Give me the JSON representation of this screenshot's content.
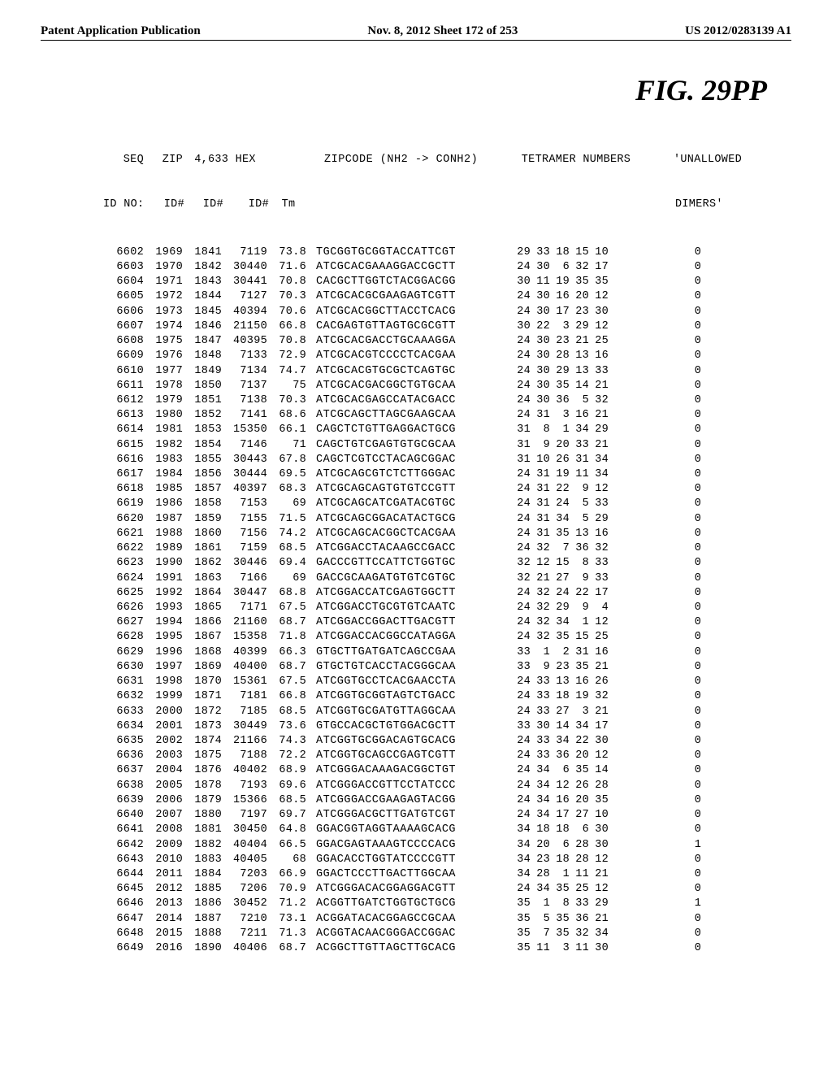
{
  "header": {
    "left": "Patent Application Publication",
    "mid": "Nov. 8, 2012  Sheet 172 of 253",
    "right": "US 2012/0283139 A1"
  },
  "figure_label": "FIG.  29PP",
  "columns": {
    "top": [
      "SEQ",
      "ZIP",
      "4,633 HEX",
      "",
      "ZIPCODE (NH2 -> CONH2)",
      "TETRAMER NUMBERS",
      "'UNALLOWED"
    ],
    "sub": [
      "ID NO:",
      "ID#",
      "ID#",
      "ID#",
      "Tm",
      "",
      "",
      "DIMERS'"
    ]
  },
  "rows": [
    {
      "seq": "6602",
      "zip": "1969",
      "h1": "1841",
      "h2": "7119",
      "tm": "73.8",
      "zc": "TGCGGTGCGGTACCATTCGT",
      "tet": [
        "29",
        "33",
        "18",
        "15",
        "10"
      ],
      "un": "0"
    },
    {
      "seq": "6603",
      "zip": "1970",
      "h1": "1842",
      "h2": "30440",
      "tm": "71.6",
      "zc": "ATCGCACGAAAGGACCGCTT",
      "tet": [
        "24",
        "30",
        "6",
        "32",
        "17"
      ],
      "un": "0"
    },
    {
      "seq": "6604",
      "zip": "1971",
      "h1": "1843",
      "h2": "30441",
      "tm": "70.8",
      "zc": "CACGCTTGGTCTACGGACGG",
      "tet": [
        "30",
        "11",
        "19",
        "35",
        "35"
      ],
      "un": "0"
    },
    {
      "seq": "6605",
      "zip": "1972",
      "h1": "1844",
      "h2": "7127",
      "tm": "70.3",
      "zc": "ATCGCACGCGAAGAGTCGTT",
      "tet": [
        "24",
        "30",
        "16",
        "20",
        "12"
      ],
      "un": "0"
    },
    {
      "seq": "6606",
      "zip": "1973",
      "h1": "1845",
      "h2": "40394",
      "tm": "70.6",
      "zc": "ATCGCACGGCTTACCTCACG",
      "tet": [
        "24",
        "30",
        "17",
        "23",
        "30"
      ],
      "un": "0"
    },
    {
      "seq": "6607",
      "zip": "1974",
      "h1": "1846",
      "h2": "21150",
      "tm": "66.8",
      "zc": "CACGAGTGTTAGTGCGCGTT",
      "tet": [
        "30",
        "22",
        "3",
        "29",
        "12"
      ],
      "un": "0"
    },
    {
      "seq": "6608",
      "zip": "1975",
      "h1": "1847",
      "h2": "40395",
      "tm": "70.8",
      "zc": "ATCGCACGACCTGCAAAGGA",
      "tet": [
        "24",
        "30",
        "23",
        "21",
        "25"
      ],
      "un": "0"
    },
    {
      "seq": "6609",
      "zip": "1976",
      "h1": "1848",
      "h2": "7133",
      "tm": "72.9",
      "zc": "ATCGCACGTCCCCTCACGAA",
      "tet": [
        "24",
        "30",
        "28",
        "13",
        "16"
      ],
      "un": "0"
    },
    {
      "seq": "6610",
      "zip": "1977",
      "h1": "1849",
      "h2": "7134",
      "tm": "74.7",
      "zc": "ATCGCACGTGCGCTCAGTGC",
      "tet": [
        "24",
        "30",
        "29",
        "13",
        "33"
      ],
      "un": "0"
    },
    {
      "seq": "6611",
      "zip": "1978",
      "h1": "1850",
      "h2": "7137",
      "tm": "75",
      "zc": "ATCGCACGACGGCTGTGCAA",
      "tet": [
        "24",
        "30",
        "35",
        "14",
        "21"
      ],
      "un": "0"
    },
    {
      "seq": "6612",
      "zip": "1979",
      "h1": "1851",
      "h2": "7138",
      "tm": "70.3",
      "zc": "ATCGCACGAGCCATACGACC",
      "tet": [
        "24",
        "30",
        "36",
        "5",
        "32"
      ],
      "un": "0"
    },
    {
      "seq": "6613",
      "zip": "1980",
      "h1": "1852",
      "h2": "7141",
      "tm": "68.6",
      "zc": "ATCGCAGCTTAGCGAAGCAA",
      "tet": [
        "24",
        "31",
        "3",
        "16",
        "21"
      ],
      "un": "0"
    },
    {
      "seq": "6614",
      "zip": "1981",
      "h1": "1853",
      "h2": "15350",
      "tm": "66.1",
      "zc": "CAGCTCTGTTGAGGACTGCG",
      "tet": [
        "31",
        "8",
        "1",
        "34",
        "29"
      ],
      "un": "0"
    },
    {
      "seq": "6615",
      "zip": "1982",
      "h1": "1854",
      "h2": "7146",
      "tm": "71",
      "zc": "CAGCTGTCGAGTGTGCGCAA",
      "tet": [
        "31",
        "9",
        "20",
        "33",
        "21"
      ],
      "un": "0"
    },
    {
      "seq": "6616",
      "zip": "1983",
      "h1": "1855",
      "h2": "30443",
      "tm": "67.8",
      "zc": "CAGCTCGTCCTACAGCGGAC",
      "tet": [
        "31",
        "10",
        "26",
        "31",
        "34"
      ],
      "un": "0"
    },
    {
      "seq": "6617",
      "zip": "1984",
      "h1": "1856",
      "h2": "30444",
      "tm": "69.5",
      "zc": "ATCGCAGCGTCTCTTGGGAC",
      "tet": [
        "24",
        "31",
        "19",
        "11",
        "34"
      ],
      "un": "0"
    },
    {
      "seq": "6618",
      "zip": "1985",
      "h1": "1857",
      "h2": "40397",
      "tm": "68.3",
      "zc": "ATCGCAGCAGTGTGTCCGTT",
      "tet": [
        "24",
        "31",
        "22",
        "9",
        "12"
      ],
      "un": "0"
    },
    {
      "seq": "6619",
      "zip": "1986",
      "h1": "1858",
      "h2": "7153",
      "tm": "69",
      "zc": "ATCGCAGCATCGATACGTGC",
      "tet": [
        "24",
        "31",
        "24",
        "5",
        "33"
      ],
      "un": "0"
    },
    {
      "seq": "6620",
      "zip": "1987",
      "h1": "1859",
      "h2": "7155",
      "tm": "71.5",
      "zc": "ATCGCAGCGGACATACTGCG",
      "tet": [
        "24",
        "31",
        "34",
        "5",
        "29"
      ],
      "un": "0"
    },
    {
      "seq": "6621",
      "zip": "1988",
      "h1": "1860",
      "h2": "7156",
      "tm": "74.2",
      "zc": "ATCGCAGCACGGCTCACGAA",
      "tet": [
        "24",
        "31",
        "35",
        "13",
        "16"
      ],
      "un": "0"
    },
    {
      "seq": "6622",
      "zip": "1989",
      "h1": "1861",
      "h2": "7159",
      "tm": "68.5",
      "zc": "ATCGGACCTACAAGCCGACC",
      "tet": [
        "24",
        "32",
        "7",
        "36",
        "32"
      ],
      "un": "0"
    },
    {
      "seq": "6623",
      "zip": "1990",
      "h1": "1862",
      "h2": "30446",
      "tm": "69.4",
      "zc": "GACCCGTTCCATTCTGGTGC",
      "tet": [
        "32",
        "12",
        "15",
        "8",
        "33"
      ],
      "un": "0"
    },
    {
      "seq": "6624",
      "zip": "1991",
      "h1": "1863",
      "h2": "7166",
      "tm": "69",
      "zc": "GACCGCAAGATGTGTCGTGC",
      "tet": [
        "32",
        "21",
        "27",
        "9",
        "33"
      ],
      "un": "0"
    },
    {
      "seq": "6625",
      "zip": "1992",
      "h1": "1864",
      "h2": "30447",
      "tm": "68.8",
      "zc": "ATCGGACCATCGAGTGGCTT",
      "tet": [
        "24",
        "32",
        "24",
        "22",
        "17"
      ],
      "un": "0"
    },
    {
      "seq": "6626",
      "zip": "1993",
      "h1": "1865",
      "h2": "7171",
      "tm": "67.5",
      "zc": "ATCGGACCTGCGTGTCAATC",
      "tet": [
        "24",
        "32",
        "29",
        "9",
        "4"
      ],
      "un": "0"
    },
    {
      "seq": "6627",
      "zip": "1994",
      "h1": "1866",
      "h2": "21160",
      "tm": "68.7",
      "zc": "ATCGGACCGGACTTGACGTT",
      "tet": [
        "24",
        "32",
        "34",
        "1",
        "12"
      ],
      "un": "0"
    },
    {
      "seq": "6628",
      "zip": "1995",
      "h1": "1867",
      "h2": "15358",
      "tm": "71.8",
      "zc": "ATCGGACCACGGCCATAGGA",
      "tet": [
        "24",
        "32",
        "35",
        "15",
        "25"
      ],
      "un": "0"
    },
    {
      "seq": "6629",
      "zip": "1996",
      "h1": "1868",
      "h2": "40399",
      "tm": "66.3",
      "zc": "GTGCTTGATGATCAGCCGAA",
      "tet": [
        "33",
        "1",
        "2",
        "31",
        "16"
      ],
      "un": "0"
    },
    {
      "seq": "6630",
      "zip": "1997",
      "h1": "1869",
      "h2": "40400",
      "tm": "68.7",
      "zc": "GTGCTGTCACCTACGGGCAA",
      "tet": [
        "33",
        "9",
        "23",
        "35",
        "21"
      ],
      "un": "0"
    },
    {
      "seq": "6631",
      "zip": "1998",
      "h1": "1870",
      "h2": "15361",
      "tm": "67.5",
      "zc": "ATCGGTGCCTCACGAACCTA",
      "tet": [
        "24",
        "33",
        "13",
        "16",
        "26"
      ],
      "un": "0"
    },
    {
      "seq": "6632",
      "zip": "1999",
      "h1": "1871",
      "h2": "7181",
      "tm": "66.8",
      "zc": "ATCGGTGCGGTAGTCTGACC",
      "tet": [
        "24",
        "33",
        "18",
        "19",
        "32"
      ],
      "un": "0"
    },
    {
      "seq": "6633",
      "zip": "2000",
      "h1": "1872",
      "h2": "7185",
      "tm": "68.5",
      "zc": "ATCGGTGCGATGTTAGGCAA",
      "tet": [
        "24",
        "33",
        "27",
        "3",
        "21"
      ],
      "un": "0"
    },
    {
      "seq": "6634",
      "zip": "2001",
      "h1": "1873",
      "h2": "30449",
      "tm": "73.6",
      "zc": "GTGCCACGCTGTGGACGCTT",
      "tet": [
        "33",
        "30",
        "14",
        "34",
        "17"
      ],
      "un": "0"
    },
    {
      "seq": "6635",
      "zip": "2002",
      "h1": "1874",
      "h2": "21166",
      "tm": "74.3",
      "zc": "ATCGGTGCGGACAGTGCACG",
      "tet": [
        "24",
        "33",
        "34",
        "22",
        "30"
      ],
      "un": "0"
    },
    {
      "seq": "6636",
      "zip": "2003",
      "h1": "1875",
      "h2": "7188",
      "tm": "72.2",
      "zc": "ATCGGTGCAGCCGAGTCGTT",
      "tet": [
        "24",
        "33",
        "36",
        "20",
        "12"
      ],
      "un": "0"
    },
    {
      "seq": "6637",
      "zip": "2004",
      "h1": "1876",
      "h2": "40402",
      "tm": "68.9",
      "zc": "ATCGGGACAAAGACGGCTGT",
      "tet": [
        "24",
        "34",
        "6",
        "35",
        "14"
      ],
      "un": "0"
    },
    {
      "seq": "6638",
      "zip": "2005",
      "h1": "1878",
      "h2": "7193",
      "tm": "69.6",
      "zc": "ATCGGGACCGTTCCTATCCC",
      "tet": [
        "24",
        "34",
        "12",
        "26",
        "28"
      ],
      "un": "0"
    },
    {
      "seq": "6639",
      "zip": "2006",
      "h1": "1879",
      "h2": "15366",
      "tm": "68.5",
      "zc": "ATCGGGACCGAAGAGTACGG",
      "tet": [
        "24",
        "34",
        "16",
        "20",
        "35"
      ],
      "un": "0"
    },
    {
      "seq": "6640",
      "zip": "2007",
      "h1": "1880",
      "h2": "7197",
      "tm": "69.7",
      "zc": "ATCGGGACGCTTGATGTCGT",
      "tet": [
        "24",
        "34",
        "17",
        "27",
        "10"
      ],
      "un": "0"
    },
    {
      "seq": "6641",
      "zip": "2008",
      "h1": "1881",
      "h2": "30450",
      "tm": "64.8",
      "zc": "GGACGGTAGGTAAAAGCACG",
      "tet": [
        "34",
        "18",
        "18",
        "6",
        "30"
      ],
      "un": "0"
    },
    {
      "seq": "6642",
      "zip": "2009",
      "h1": "1882",
      "h2": "40404",
      "tm": "66.5",
      "zc": "GGACGAGTAAAGTCCCCACG",
      "tet": [
        "34",
        "20",
        "6",
        "28",
        "30"
      ],
      "un": "1"
    },
    {
      "seq": "6643",
      "zip": "2010",
      "h1": "1883",
      "h2": "40405",
      "tm": "68",
      "zc": "GGACACCTGGTATCCCCGTT",
      "tet": [
        "34",
        "23",
        "18",
        "28",
        "12"
      ],
      "un": "0"
    },
    {
      "seq": "6644",
      "zip": "2011",
      "h1": "1884",
      "h2": "7203",
      "tm": "66.9",
      "zc": "GGACTCCCTTGACTTGGCAA",
      "tet": [
        "34",
        "28",
        "1",
        "11",
        "21"
      ],
      "un": "0"
    },
    {
      "seq": "6645",
      "zip": "2012",
      "h1": "1885",
      "h2": "7206",
      "tm": "70.9",
      "zc": "ATCGGGACACGGAGGACGTT",
      "tet": [
        "24",
        "34",
        "35",
        "25",
        "12"
      ],
      "un": "0"
    },
    {
      "seq": "6646",
      "zip": "2013",
      "h1": "1886",
      "h2": "30452",
      "tm": "71.2",
      "zc": "ACGGTTGATCTGGTGCTGCG",
      "tet": [
        "35",
        "1",
        "8",
        "33",
        "29"
      ],
      "un": "1"
    },
    {
      "seq": "6647",
      "zip": "2014",
      "h1": "1887",
      "h2": "7210",
      "tm": "73.1",
      "zc": "ACGGATACACGGAGCCGCAA",
      "tet": [
        "35",
        "5",
        "35",
        "36",
        "21"
      ],
      "un": "0"
    },
    {
      "seq": "6648",
      "zip": "2015",
      "h1": "1888",
      "h2": "7211",
      "tm": "71.3",
      "zc": "ACGGTACAACGGGACCGGAC",
      "tet": [
        "35",
        "7",
        "35",
        "32",
        "34"
      ],
      "un": "0"
    },
    {
      "seq": "6649",
      "zip": "2016",
      "h1": "1890",
      "h2": "40406",
      "tm": "68.7",
      "zc": "ACGGCTTGTTAGCTTGCACG",
      "tet": [
        "35",
        "11",
        "3",
        "11",
        "30"
      ],
      "un": "0"
    }
  ]
}
